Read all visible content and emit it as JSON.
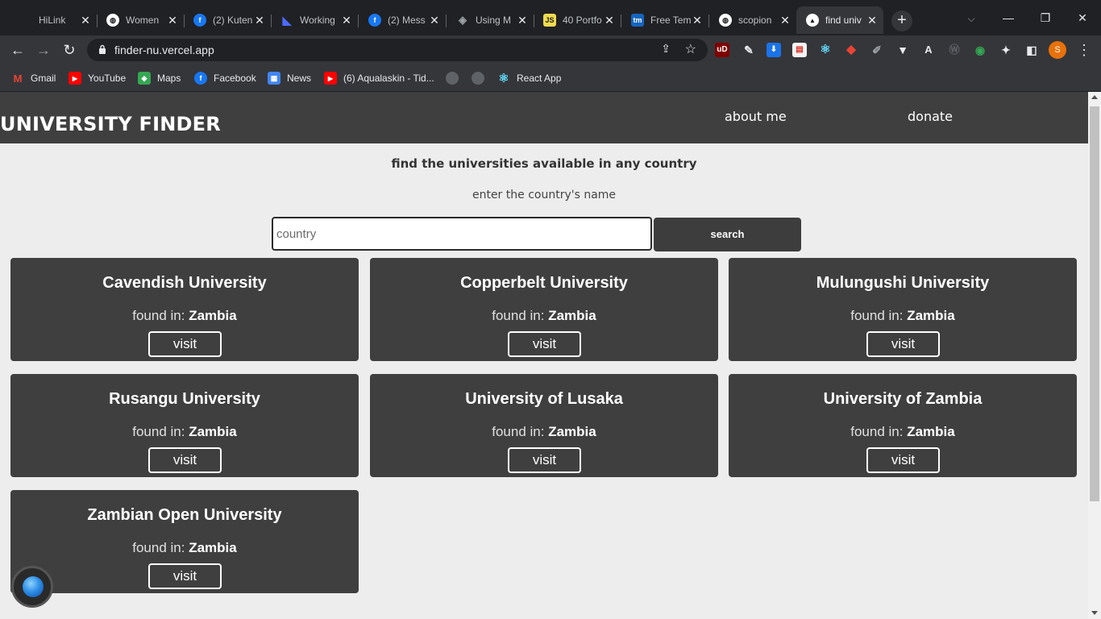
{
  "browser": {
    "tabs": [
      {
        "title": "HiLink",
        "icon": "blank-icon",
        "color": "#202124"
      },
      {
        "title": "Women",
        "icon": "globe-icon",
        "color": "#ffffff"
      },
      {
        "title": "(2) Kuten",
        "icon": "facebook-icon",
        "color": "#1877f2"
      },
      {
        "title": "Working",
        "icon": "arrow-logo-icon",
        "color": "#4b6bfb"
      },
      {
        "title": "(2) Mess",
        "icon": "facebook-icon",
        "color": "#1877f2"
      },
      {
        "title": "Using M",
        "icon": "diamond-logo-icon",
        "color": "#9aa0a6"
      },
      {
        "title": "40 Portfo",
        "icon": "js-icon",
        "color": "#f0db4f"
      },
      {
        "title": "Free Tem",
        "icon": "tm-icon",
        "color": "#1565c0"
      },
      {
        "title": "scopion",
        "icon": "globe-icon",
        "color": "#ffffff"
      },
      {
        "title": "find univ",
        "icon": "vercel-icon",
        "color": "#ffffff"
      }
    ],
    "url": "finder-nu.vercel.app",
    "profile_initial": "S",
    "bookmarks": [
      {
        "label": "Gmail",
        "icon": "gmail-icon",
        "color": "#ea4335"
      },
      {
        "label": "YouTube",
        "icon": "youtube-icon",
        "color": "#ff0000"
      },
      {
        "label": "Maps",
        "icon": "maps-icon",
        "color": "#34a853"
      },
      {
        "label": "Facebook",
        "icon": "facebook-icon",
        "color": "#1877f2"
      },
      {
        "label": "News",
        "icon": "news-icon",
        "color": "#4285f4"
      },
      {
        "label": "(6) Aqualaskin - Tid...",
        "icon": "youtube-icon",
        "color": "#ff0000"
      },
      {
        "label": "",
        "icon": "globe-icon",
        "color": "#9aa0a6"
      },
      {
        "label": "",
        "icon": "globe-icon",
        "color": "#9aa0a6"
      },
      {
        "label": "React App",
        "icon": "react-icon",
        "color": "#61dafb"
      }
    ]
  },
  "site": {
    "logo": "UNIVERSITY FINDER",
    "nav": {
      "about": "about me",
      "donate": "donate"
    },
    "headline": "find the universities available in any country",
    "subline": "enter the country's name",
    "search": {
      "placeholder": "country",
      "value": "",
      "button_label": "search"
    },
    "found_label": "found in:",
    "visit_label": "visit",
    "results": [
      {
        "name": "Cavendish University",
        "country": "Zambia"
      },
      {
        "name": "Copperbelt University",
        "country": "Zambia"
      },
      {
        "name": "Mulungushi University",
        "country": "Zambia"
      },
      {
        "name": "Rusangu University",
        "country": "Zambia"
      },
      {
        "name": "University of Lusaka",
        "country": "Zambia"
      },
      {
        "name": "University of Zambia",
        "country": "Zambia"
      },
      {
        "name": "Zambian Open University",
        "country": "Zambia"
      }
    ]
  }
}
